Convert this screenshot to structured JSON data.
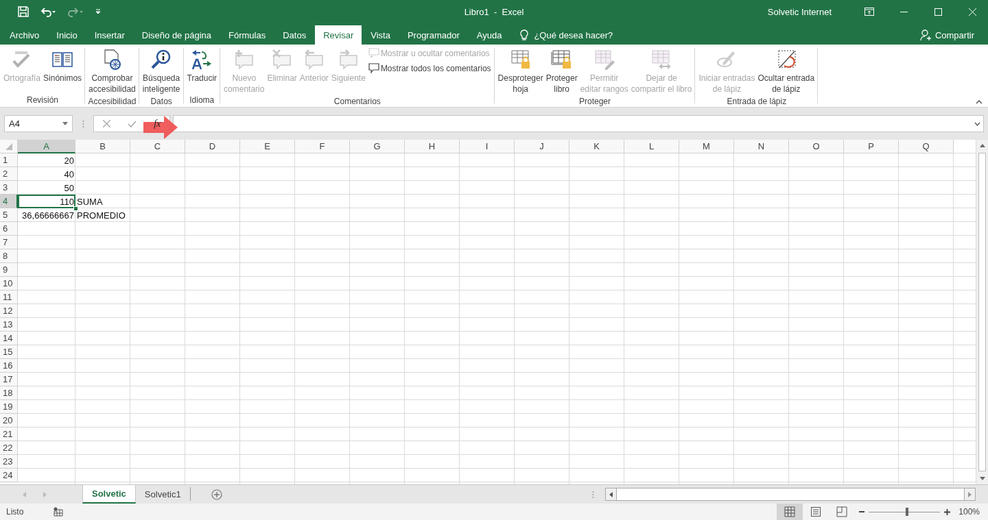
{
  "window": {
    "title": "Libro1  -  Excel",
    "user": "Solvetic Internet"
  },
  "quick_access": {
    "redo": {
      "disabled": true
    }
  },
  "tabs": [
    {
      "label": "Archivo",
      "selected": false
    },
    {
      "label": "Inicio",
      "selected": false
    },
    {
      "label": "Insertar",
      "selected": false
    },
    {
      "label": "Diseño de página",
      "selected": false
    },
    {
      "label": "Fórmulas",
      "selected": false
    },
    {
      "label": "Datos",
      "selected": false
    },
    {
      "label": "Revisar",
      "selected": true
    },
    {
      "label": "Vista",
      "selected": false
    },
    {
      "label": "Programador",
      "selected": false
    },
    {
      "label": "Ayuda",
      "selected": false
    }
  ],
  "tell_me": {
    "placeholder": "¿Qué desea hacer?"
  },
  "share": {
    "label": "Compartir"
  },
  "ribbon": {
    "groups": [
      {
        "label": "Revisión",
        "items": [
          {
            "kind": "large",
            "label": "Ortografía",
            "disabled": true
          },
          {
            "kind": "large",
            "label": "Sinónimos",
            "disabled": false
          }
        ]
      },
      {
        "label": "Accesibilidad",
        "items": [
          {
            "kind": "large",
            "label": "Comprobar\naccesibilidad",
            "disabled": false
          }
        ]
      },
      {
        "label": "Datos",
        "items": [
          {
            "kind": "large",
            "label": "Búsqueda\ninteligente",
            "disabled": false
          }
        ]
      },
      {
        "label": "Idioma",
        "items": [
          {
            "kind": "large",
            "label": "Traducir",
            "disabled": false
          }
        ]
      },
      {
        "label": "Comentarios",
        "items": [
          {
            "kind": "large",
            "label": "Nuevo\ncomentario",
            "disabled": true
          },
          {
            "kind": "large",
            "label": "Eliminar",
            "disabled": true
          },
          {
            "kind": "large",
            "label": "Anterior",
            "disabled": true
          },
          {
            "kind": "large",
            "label": "Siguiente",
            "disabled": true
          },
          {
            "kind": "small",
            "label": "Mostrar u ocultar comentarios",
            "disabled": true
          },
          {
            "kind": "small",
            "label": "Mostrar todos los comentarios",
            "disabled": false
          }
        ]
      },
      {
        "label": "Proteger",
        "items": [
          {
            "kind": "large",
            "label": "Desproteger\nhoja",
            "disabled": false
          },
          {
            "kind": "large",
            "label": "Proteger\nlibro",
            "disabled": false
          },
          {
            "kind": "large",
            "label": "Permitir\neditar rangos",
            "disabled": true
          },
          {
            "kind": "large",
            "label": "Dejar de\ncompartir el libro",
            "disabled": true
          }
        ]
      },
      {
        "label": "Entrada de lápiz",
        "items": [
          {
            "kind": "large",
            "label": "Iniciar entradas\nde lápiz",
            "disabled": true
          },
          {
            "kind": "large",
            "label": "Ocultar entrada\nde lápiz",
            "disabled": false
          }
        ]
      }
    ]
  },
  "formula_bar": {
    "name_box": "A4",
    "fx": "fx"
  },
  "sheet": {
    "columns": [
      {
        "label": "A",
        "selected": true
      },
      {
        "label": "B",
        "selected": false
      },
      {
        "label": "C",
        "selected": false
      },
      {
        "label": "D",
        "selected": false
      },
      {
        "label": "E",
        "selected": false
      },
      {
        "label": "F",
        "selected": false
      },
      {
        "label": "G",
        "selected": false
      },
      {
        "label": "H",
        "selected": false
      },
      {
        "label": "I",
        "selected": false
      },
      {
        "label": "J",
        "selected": false
      },
      {
        "label": "K",
        "selected": false
      },
      {
        "label": "L",
        "selected": false
      },
      {
        "label": "M",
        "selected": false
      },
      {
        "label": "N",
        "selected": false
      },
      {
        "label": "O",
        "selected": false
      },
      {
        "label": "P",
        "selected": false
      },
      {
        "label": "Q",
        "selected": false
      }
    ],
    "rows": [
      {
        "label": "1",
        "selected": false,
        "cells": [
          {
            "text": "20",
            "kind": "number",
            "selected": false
          }
        ]
      },
      {
        "label": "2",
        "selected": false,
        "cells": [
          {
            "text": "40",
            "kind": "number",
            "selected": false
          }
        ]
      },
      {
        "label": "3",
        "selected": false,
        "cells": [
          {
            "text": "50",
            "kind": "number",
            "selected": false
          }
        ]
      },
      {
        "label": "4",
        "selected": true,
        "cells": [
          {
            "text": "110",
            "kind": "number",
            "selected": true
          },
          {
            "text": "SUMA",
            "kind": "text",
            "selected": false
          }
        ]
      },
      {
        "label": "5",
        "selected": false,
        "cells": [
          {
            "text": "36,66666667",
            "kind": "number",
            "selected": false
          },
          {
            "text": "PROMEDIO",
            "kind": "text",
            "selected": false
          }
        ]
      },
      {
        "label": "6",
        "selected": false
      },
      {
        "label": "7",
        "selected": false
      },
      {
        "label": "8",
        "selected": false
      },
      {
        "label": "9",
        "selected": false
      },
      {
        "label": "10",
        "selected": false
      },
      {
        "label": "11",
        "selected": false
      },
      {
        "label": "12",
        "selected": false
      },
      {
        "label": "13",
        "selected": false
      },
      {
        "label": "14",
        "selected": false
      },
      {
        "label": "15",
        "selected": false
      },
      {
        "label": "16",
        "selected": false
      },
      {
        "label": "17",
        "selected": false
      },
      {
        "label": "18",
        "selected": false
      },
      {
        "label": "19",
        "selected": false
      },
      {
        "label": "20",
        "selected": false
      },
      {
        "label": "21",
        "selected": false
      },
      {
        "label": "22",
        "selected": false
      },
      {
        "label": "23",
        "selected": false
      },
      {
        "label": "24",
        "selected": false
      }
    ]
  },
  "sheet_tabs": [
    {
      "label": "Solvetic",
      "selected": true
    },
    {
      "label": "Solvetic1",
      "selected": false
    }
  ],
  "status_bar": {
    "status": "Listo",
    "views": [
      {
        "selected": true
      },
      {
        "selected": false
      },
      {
        "selected": false
      }
    ],
    "zoom": {
      "level": 0.52,
      "reading": "100%"
    }
  }
}
